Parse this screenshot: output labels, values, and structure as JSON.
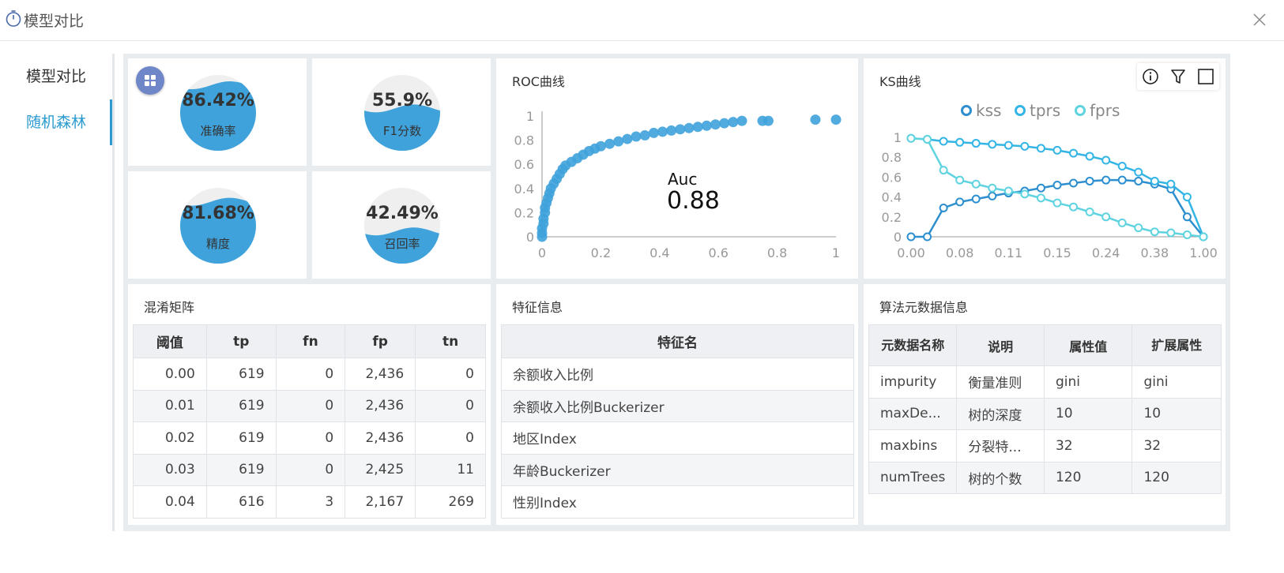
{
  "window": {
    "title": "模型对比",
    "title_icon": "stopwatch-icon",
    "close_icon": "close-icon"
  },
  "sidebar": {
    "items": [
      {
        "label": "模型对比",
        "active": false
      },
      {
        "label": "随机森林",
        "active": true
      }
    ]
  },
  "metrics": [
    {
      "value": "86.42%",
      "label": "准确率",
      "fill": 0.8642
    },
    {
      "value": "55.9%",
      "label": "F1分数",
      "fill": 0.559
    },
    {
      "value": "81.68%",
      "label": "精度",
      "fill": 0.8168
    },
    {
      "value": "42.49%",
      "label": "召回率",
      "fill": 0.4249
    }
  ],
  "colors": {
    "accent": "#2b9bd0",
    "gauge_fill": "#3fa2db",
    "kss": "#2e8fcf",
    "tprs": "#33b5e5",
    "fprs": "#5fd3e0"
  },
  "roc": {
    "title": "ROC曲线",
    "auc_label": "Auc",
    "auc_value": "0.88",
    "chart_data": {
      "type": "scatter",
      "title": "ROC曲线",
      "xlim": [
        0,
        1
      ],
      "ylim": [
        0,
        1
      ],
      "xticks": [
        "0",
        "0.2",
        "0.4",
        "0.6",
        "0.8",
        "1"
      ],
      "yticks": [
        "0",
        "0.2",
        "0.4",
        "0.6",
        "0.8",
        "1"
      ],
      "points": [
        [
          0.0,
          0.0
        ],
        [
          0.0,
          0.03
        ],
        [
          0.0,
          0.07
        ],
        [
          0.005,
          0.11
        ],
        [
          0.005,
          0.15
        ],
        [
          0.01,
          0.2
        ],
        [
          0.01,
          0.24
        ],
        [
          0.015,
          0.28
        ],
        [
          0.02,
          0.32
        ],
        [
          0.025,
          0.36
        ],
        [
          0.03,
          0.4
        ],
        [
          0.04,
          0.44
        ],
        [
          0.05,
          0.48
        ],
        [
          0.06,
          0.52
        ],
        [
          0.07,
          0.56
        ],
        [
          0.08,
          0.59
        ],
        [
          0.1,
          0.62
        ],
        [
          0.12,
          0.65
        ],
        [
          0.14,
          0.68
        ],
        [
          0.16,
          0.71
        ],
        [
          0.18,
          0.73
        ],
        [
          0.2,
          0.75
        ],
        [
          0.23,
          0.77
        ],
        [
          0.26,
          0.79
        ],
        [
          0.29,
          0.81
        ],
        [
          0.32,
          0.83
        ],
        [
          0.35,
          0.84
        ],
        [
          0.38,
          0.86
        ],
        [
          0.41,
          0.87
        ],
        [
          0.44,
          0.88
        ],
        [
          0.47,
          0.89
        ],
        [
          0.5,
          0.9
        ],
        [
          0.53,
          0.91
        ],
        [
          0.56,
          0.92
        ],
        [
          0.59,
          0.93
        ],
        [
          0.62,
          0.94
        ],
        [
          0.65,
          0.95
        ],
        [
          0.68,
          0.96
        ],
        [
          0.75,
          0.96
        ],
        [
          0.77,
          0.96
        ],
        [
          0.93,
          0.97
        ],
        [
          1.0,
          0.97
        ]
      ]
    }
  },
  "ks": {
    "title": "KS曲线",
    "tools": [
      "info-icon",
      "filter-icon",
      "maximize-icon"
    ],
    "chart_data": {
      "type": "line",
      "title": "KS曲线",
      "ylim": [
        0,
        1
      ],
      "yticks": [
        "0",
        "0.2",
        "0.4",
        "0.6",
        "0.8",
        "1"
      ],
      "xticks": [
        "0.00",
        "0.08",
        "0.11",
        "0.15",
        "0.24",
        "0.38",
        "1.00"
      ],
      "n_points": 19,
      "legend_position": "top",
      "series": [
        {
          "name": "kss",
          "values": [
            0.0,
            0.0,
            0.29,
            0.35,
            0.38,
            0.41,
            0.44,
            0.46,
            0.49,
            0.52,
            0.54,
            0.56,
            0.57,
            0.57,
            0.56,
            0.53,
            0.48,
            0.2,
            0.0
          ]
        },
        {
          "name": "tprs",
          "values": [
            0.99,
            0.98,
            0.96,
            0.95,
            0.94,
            0.93,
            0.92,
            0.91,
            0.89,
            0.87,
            0.84,
            0.81,
            0.77,
            0.71,
            0.65,
            0.56,
            0.53,
            0.4,
            0.0
          ]
        },
        {
          "name": "fprs",
          "values": [
            0.99,
            0.98,
            0.67,
            0.57,
            0.53,
            0.49,
            0.46,
            0.43,
            0.39,
            0.34,
            0.3,
            0.25,
            0.2,
            0.14,
            0.09,
            0.05,
            0.04,
            0.02,
            0.0
          ]
        }
      ]
    }
  },
  "confusion": {
    "title": "混淆矩阵",
    "headers": [
      "阈值",
      "tp",
      "fn",
      "fp",
      "tn"
    ],
    "rows": [
      [
        "0.00",
        "619",
        "0",
        "2,436",
        "0"
      ],
      [
        "0.01",
        "619",
        "0",
        "2,436",
        "0"
      ],
      [
        "0.02",
        "619",
        "0",
        "2,436",
        "0"
      ],
      [
        "0.03",
        "619",
        "0",
        "2,425",
        "11"
      ],
      [
        "0.04",
        "616",
        "3",
        "2,167",
        "269"
      ]
    ]
  },
  "features": {
    "title": "特征信息",
    "header": "特征名",
    "rows": [
      "余额收入比例",
      "余额收入比例Buckerizer",
      "地区Index",
      "年龄Buckerizer",
      "性别Index"
    ]
  },
  "meta": {
    "title": "算法元数据信息",
    "headers": [
      "元数据名称",
      "说明",
      "属性值",
      "扩展属性"
    ],
    "rows": [
      [
        "impurity",
        "衡量准则",
        "gini",
        "gini"
      ],
      [
        "maxDe...",
        "树的深度",
        "10",
        "10"
      ],
      [
        "maxbins",
        "分裂特...",
        "32",
        "32"
      ],
      [
        "numTrees",
        "树的个数",
        "120",
        "120"
      ]
    ]
  }
}
